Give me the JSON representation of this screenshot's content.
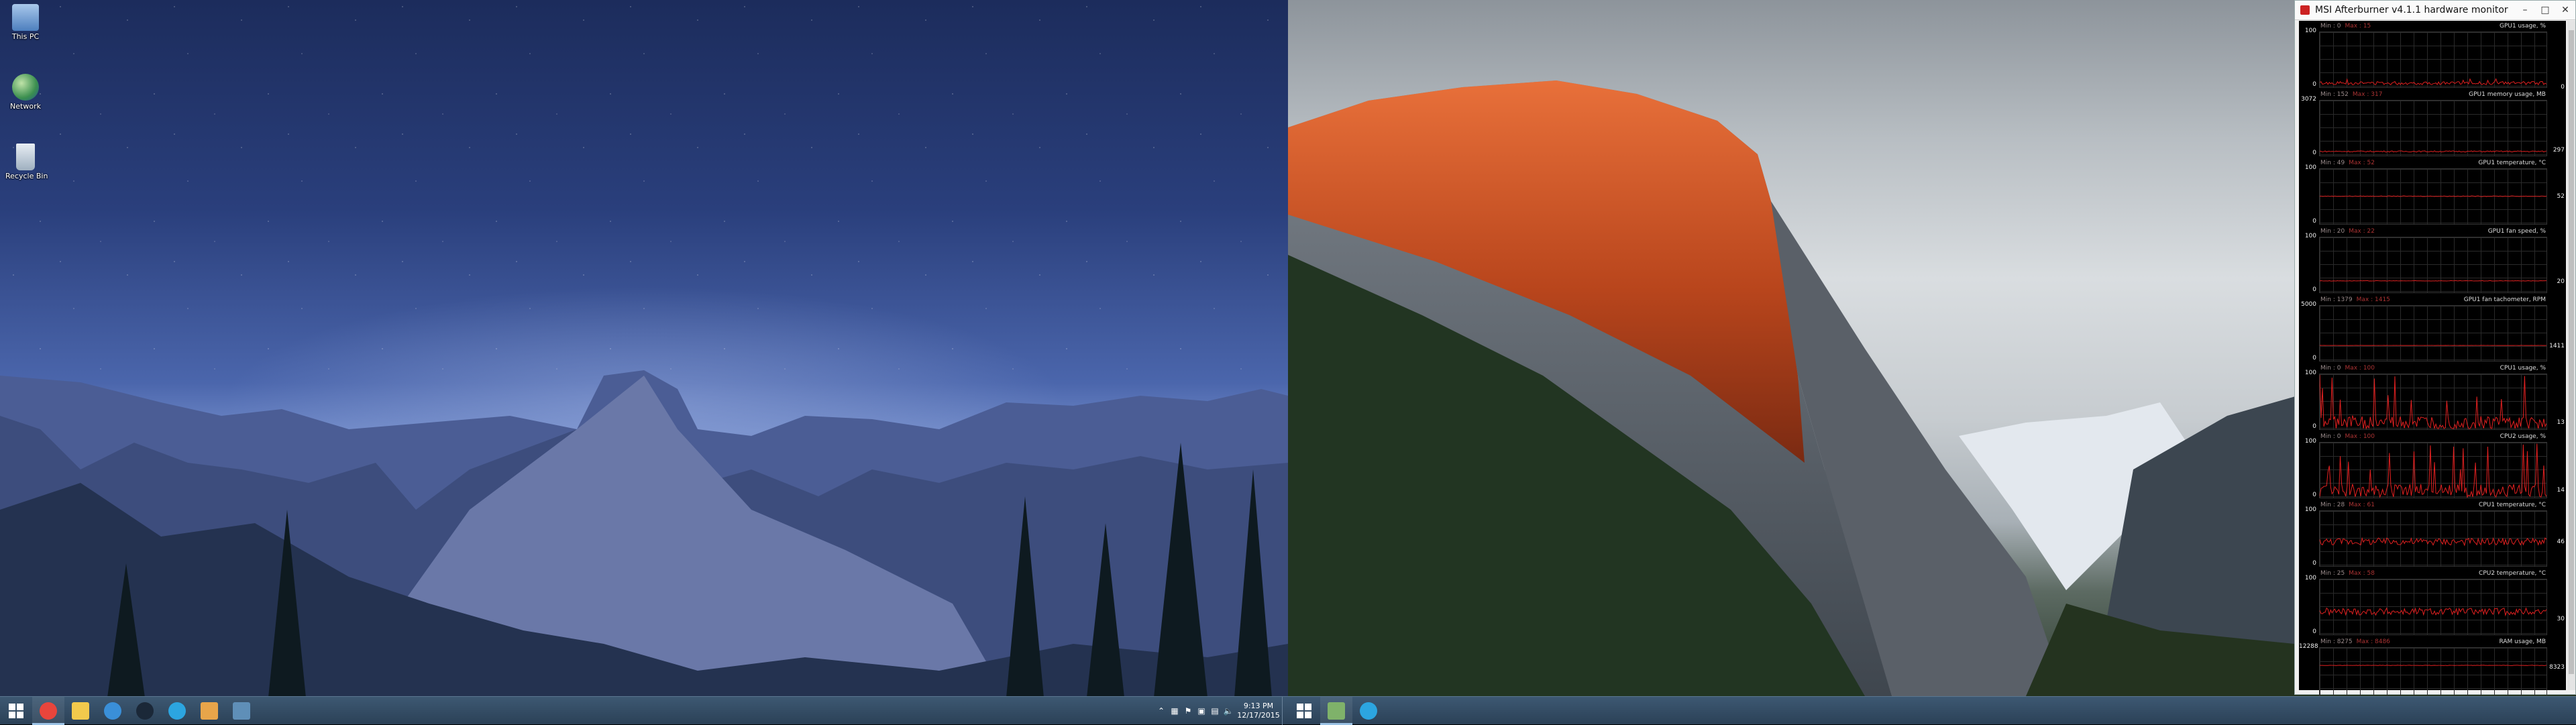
{
  "desktop": {
    "icons": [
      {
        "label": "This PC",
        "icon": "computer-icon"
      },
      {
        "label": "Network",
        "icon": "network-globe-icon"
      },
      {
        "label": "Recycle Bin",
        "icon": "recycle-bin-icon"
      }
    ]
  },
  "afterburner": {
    "title": "MSI Afterburner v4.1.1 hardware monitor",
    "graphs": [
      {
        "name": "GPU1 usage, %",
        "min_label": "Min : 0",
        "max_label": "Max : 15",
        "ymax": "100",
        "ymin": "0",
        "current": "0"
      },
      {
        "name": "GPU1 memory usage, MB",
        "min_label": "Min : 152",
        "max_label": "Max : 317",
        "ymax": "3072",
        "ymin": "0",
        "current": "297"
      },
      {
        "name": "GPU1 temperature, °C",
        "min_label": "Min : 49",
        "max_label": "Max : 52",
        "ymax": "100",
        "ymin": "0",
        "current": "52"
      },
      {
        "name": "GPU1 fan speed, %",
        "min_label": "Min : 20",
        "max_label": "Max : 22",
        "ymax": "100",
        "ymin": "0",
        "current": "20"
      },
      {
        "name": "GPU1 fan tachometer, RPM",
        "min_label": "Min : 1379",
        "max_label": "Max : 1415",
        "ymax": "5000",
        "ymin": "0",
        "current": "1411"
      },
      {
        "name": "CPU1 usage, %",
        "min_label": "Min : 0",
        "max_label": "Max : 100",
        "ymax": "100",
        "ymin": "0",
        "current": "13"
      },
      {
        "name": "CPU2 usage, %",
        "min_label": "Min : 0",
        "max_label": "Max : 100",
        "ymax": "100",
        "ymin": "0",
        "current": "14"
      },
      {
        "name": "CPU1 temperature, °C",
        "min_label": "Min : 28",
        "max_label": "Max : 61",
        "ymax": "100",
        "ymin": "0",
        "current": "46"
      },
      {
        "name": "CPU2 temperature, °C",
        "min_label": "Min : 25",
        "max_label": "Max : 58",
        "ymax": "100",
        "ymin": "0",
        "current": "30"
      },
      {
        "name": "RAM usage, MB",
        "min_label": "Min : 8275",
        "max_label": "Max : 8486",
        "ymax": "12288",
        "ymin": "0",
        "current": "8323"
      }
    ],
    "colors": {
      "trace": "#e02020",
      "grid": "#2a2a2a",
      "background": "#000000"
    }
  },
  "taskbar_left": {
    "apps": [
      {
        "icon": "chrome-icon",
        "color": "#e8453c"
      },
      {
        "icon": "file-explorer-icon",
        "color": "#f2c94c"
      },
      {
        "icon": "origin-icon",
        "color": "#3a8fd8"
      },
      {
        "icon": "steam-icon",
        "color": "#1b2838"
      },
      {
        "icon": "telegram-icon",
        "color": "#2ca5e0"
      },
      {
        "icon": "media-player-icon",
        "color": "#e8a54a"
      },
      {
        "icon": "app-window-icon",
        "color": "#5f8fb8"
      }
    ],
    "clock_time": "9:13 PM",
    "clock_date": "12/17/2015"
  },
  "taskbar_right": {
    "apps": [
      {
        "icon": "afterburner-icon",
        "color": "#7fb26a"
      },
      {
        "icon": "telegram-icon",
        "color": "#2ca5e0"
      }
    ]
  }
}
